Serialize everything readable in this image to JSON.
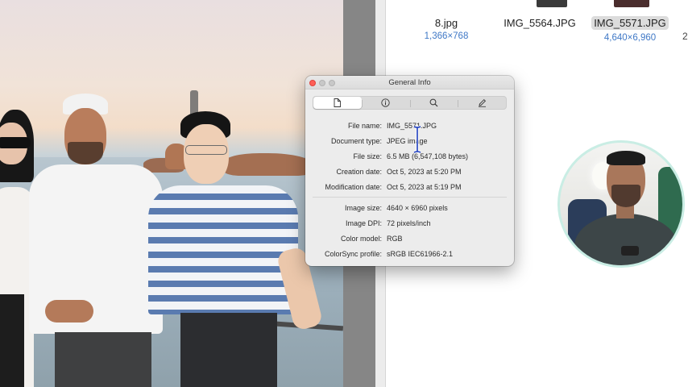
{
  "finder": {
    "files": [
      {
        "name": "8.jpg",
        "dims": "1,366×768",
        "selected": false
      },
      {
        "name": "IMG_5564.JPG",
        "dims": "",
        "selected": false
      },
      {
        "name": "IMG_5571.JPG",
        "dims": "4,640×6,960",
        "selected": true
      }
    ],
    "partial_label": "2"
  },
  "info_window": {
    "title": "General Info",
    "tabs": [
      {
        "icon": "document-icon",
        "active": true
      },
      {
        "icon": "info-icon",
        "active": false
      },
      {
        "icon": "magnifier-icon",
        "active": false
      },
      {
        "icon": "pencil-icon",
        "active": false
      }
    ],
    "rows": [
      {
        "label": "File name:",
        "value": "IMG_5571.JPG"
      },
      {
        "label": "Document type:",
        "value": "JPEG image"
      },
      {
        "label": "File size:",
        "value": "6.5 MB (6,547,108 bytes)"
      },
      {
        "label": "Creation date:",
        "value": "Oct 5, 2023 at 5:20 PM"
      },
      {
        "label": "Modification date:",
        "value": "Oct 5, 2023 at 5:19 PM"
      },
      {
        "label": "Image size:",
        "value": "4640 × 6960 pixels"
      },
      {
        "label": "Image DPI:",
        "value": "72 pixels/inch"
      },
      {
        "label": "Color model:",
        "value": "RGB"
      },
      {
        "label": "ColorSync profile:",
        "value": "sRGB IEC61966-2.1"
      }
    ]
  },
  "colors": {
    "close": "#fe5f57",
    "minimize": "#c8c8c8",
    "zoom": "#c8c8c8",
    "link_blue": "#3f78c6",
    "cam_ring": "#c9ede4"
  }
}
